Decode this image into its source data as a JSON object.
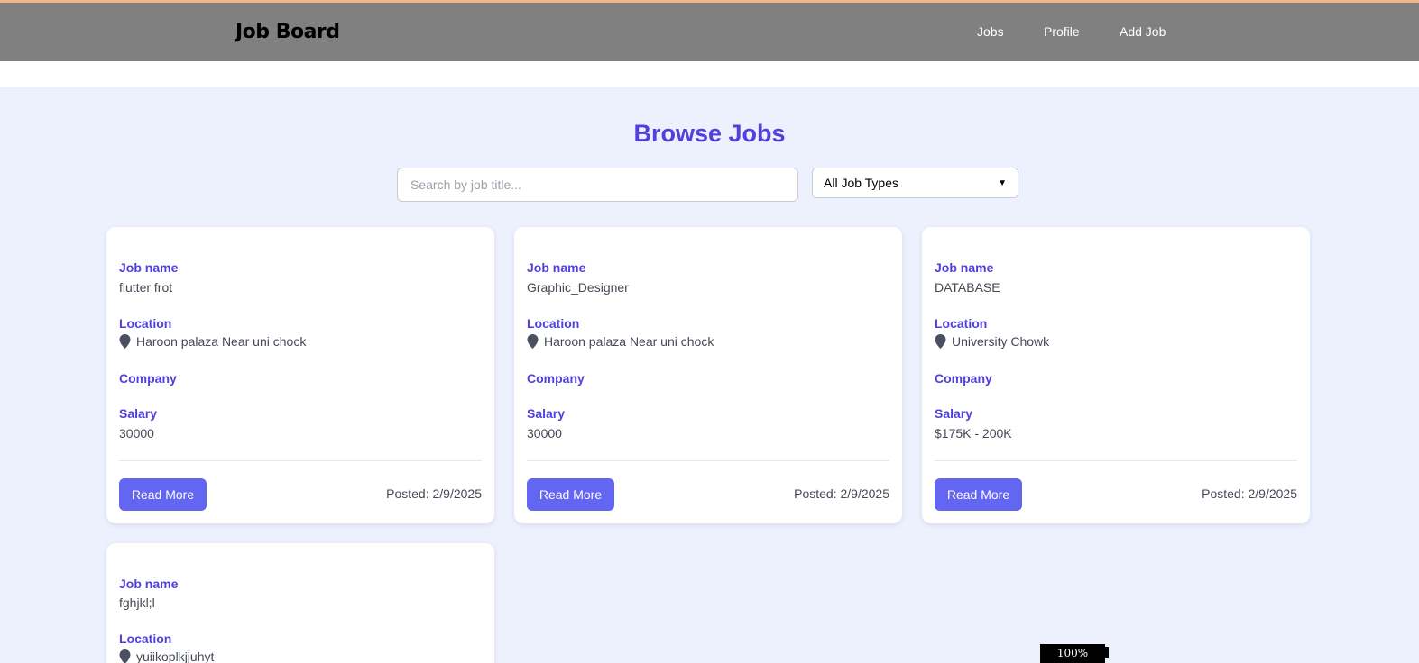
{
  "navbar": {
    "brand": "Job Board",
    "links": [
      "Jobs",
      "Profile",
      "Add Job"
    ]
  },
  "page": {
    "title": "Browse Jobs",
    "search_placeholder": "Search by job title...",
    "filter_selected": "All Job Types"
  },
  "labels": {
    "job_name": "Job name",
    "location": "Location",
    "company": "Company",
    "salary": "Salary",
    "read_more": "Read More"
  },
  "jobs": [
    {
      "name": "flutter frot",
      "location": "Haroon palaza Near uni chock",
      "company": "",
      "salary": "30000",
      "posted": "Posted: 2/9/2025"
    },
    {
      "name": "Graphic_Designer",
      "location": "Haroon palaza Near uni chock",
      "company": "",
      "salary": "30000",
      "posted": "Posted: 2/9/2025"
    },
    {
      "name": "DATABASE",
      "location": "University Chowk",
      "company": "",
      "salary": "$175K - 200K",
      "posted": "Posted: 2/9/2025"
    },
    {
      "name": "fghjkl;l",
      "location": "yuiikoplkjjuhyt"
    }
  ],
  "zoom": "100%",
  "colors": {
    "accent": "#5140da",
    "button": "#6366f1",
    "navbar": "#808080",
    "background": "#edf1fd"
  }
}
